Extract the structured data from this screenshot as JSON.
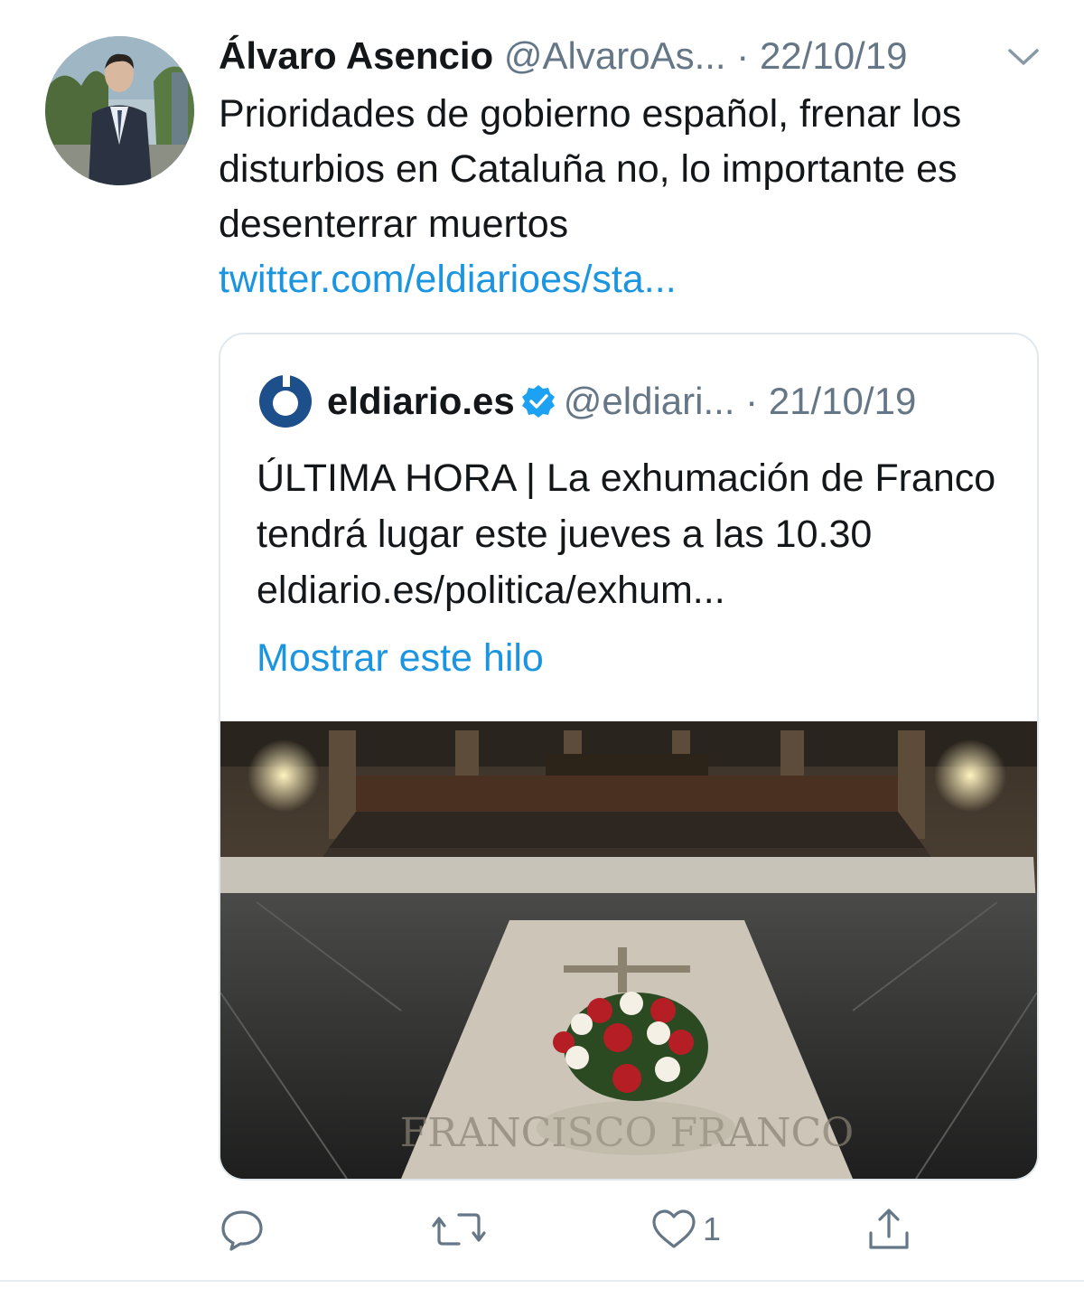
{
  "tweet": {
    "author_name": "Álvaro Asencio",
    "author_handle": "@AlvaroAs...",
    "separator": "·",
    "date": "22/10/19",
    "text": "Prioridades de gobierno español, frenar los disturbios en Cataluña no, lo importante es desenterrar muertos",
    "link": "twitter.com/eldiarioes/sta...",
    "avatar_icon": "profile-photo",
    "menu_icon": "chevron-down-icon"
  },
  "quoted_tweet": {
    "author_name": "eldiario.es",
    "author_handle": "@eldiari...",
    "separator": "·",
    "date": "21/10/19",
    "text": "ÚLTIMA HORA | La exhumación de Franco tendrá lugar este jueves a las 10.30 eldiario.es/politica/exhum...",
    "show_thread": "Mostrar este hilo",
    "logo_icon": "eldiario-logo",
    "verified_icon": "verified-badge-icon",
    "image_description_icon": "tomb-photo",
    "image_engraving": "FRANCISCO FRANCO"
  },
  "actions": {
    "reply_icon": "reply-icon",
    "retweet_icon": "retweet-icon",
    "like_icon": "heart-icon",
    "like_count": "1",
    "share_icon": "share-icon"
  },
  "colors": {
    "link": "#1b95e0",
    "text": "#14171a",
    "secondary": "#657786",
    "border": "#e1e8ed"
  }
}
